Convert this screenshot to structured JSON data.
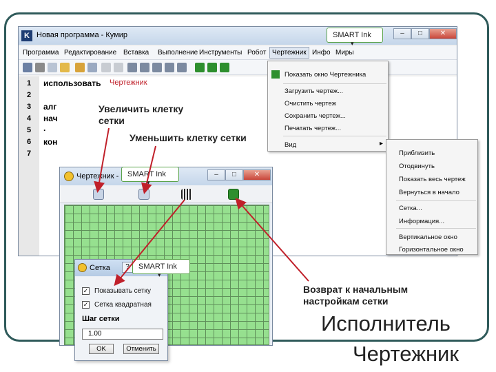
{
  "kumir": {
    "title": "Новая программа - Кумир",
    "logo": "K",
    "menu": [
      "Программа",
      "Редактирование",
      "Вставка",
      "Выполнение",
      "Инструменты",
      "Робот",
      "Чертежник",
      "Инфо",
      "Миры"
    ],
    "lines": [
      "1",
      "2",
      "3",
      "4",
      "5",
      "6",
      "7"
    ],
    "code": {
      "line1_kw": "использовать",
      "line1_mod": "Чертежник",
      "line3": "алг",
      "line4": "нач",
      "line5": ".",
      "line6": "кон"
    }
  },
  "dropdown": {
    "items": [
      "Показать окно Чертежника",
      "Загрузить чертеж...",
      "Очистить чертеж",
      "Сохранить чертеж...",
      "Печатать чертеж...",
      "Вид"
    ],
    "submenu_arrow": "▸"
  },
  "submenu": {
    "items": [
      "Приблизить",
      "Отодвинуть",
      "Показать весь чертеж",
      "Вернуться в начало",
      "Сетка...",
      "Информация...",
      "Вертикальное окно",
      "Горизонтальное окно"
    ]
  },
  "smart_ink": {
    "label": "SMART Ink",
    "caret": "▾"
  },
  "drawer": {
    "title": "Чертежник -"
  },
  "setka": {
    "title": "Сетка",
    "show_grid": "Показывать сетку",
    "square_grid": "Сетка квадратная",
    "step_label": "Шаг сетки",
    "step_value": "1.00",
    "ok": "OK",
    "cancel": "Отменить",
    "check": "✓"
  },
  "annotations": {
    "zoom_in_l1": "Увеличить клетку",
    "zoom_in_l2": "сетки",
    "zoom_out": "Уменьшить клетку сетки",
    "reset_l1": "Возврат к начальным",
    "reset_l2": "настройкам сетки",
    "big1": "Исполнитель",
    "big2": "Чертежник"
  },
  "window_buttons": {
    "min": "–",
    "max": "□",
    "close": "✕",
    "help": "?"
  },
  "colors": {
    "grid_fill": "#96e08f",
    "frame": "#2f5a5a",
    "arrow": "#c0202a",
    "smart_ink_border": "#5aa34a"
  }
}
